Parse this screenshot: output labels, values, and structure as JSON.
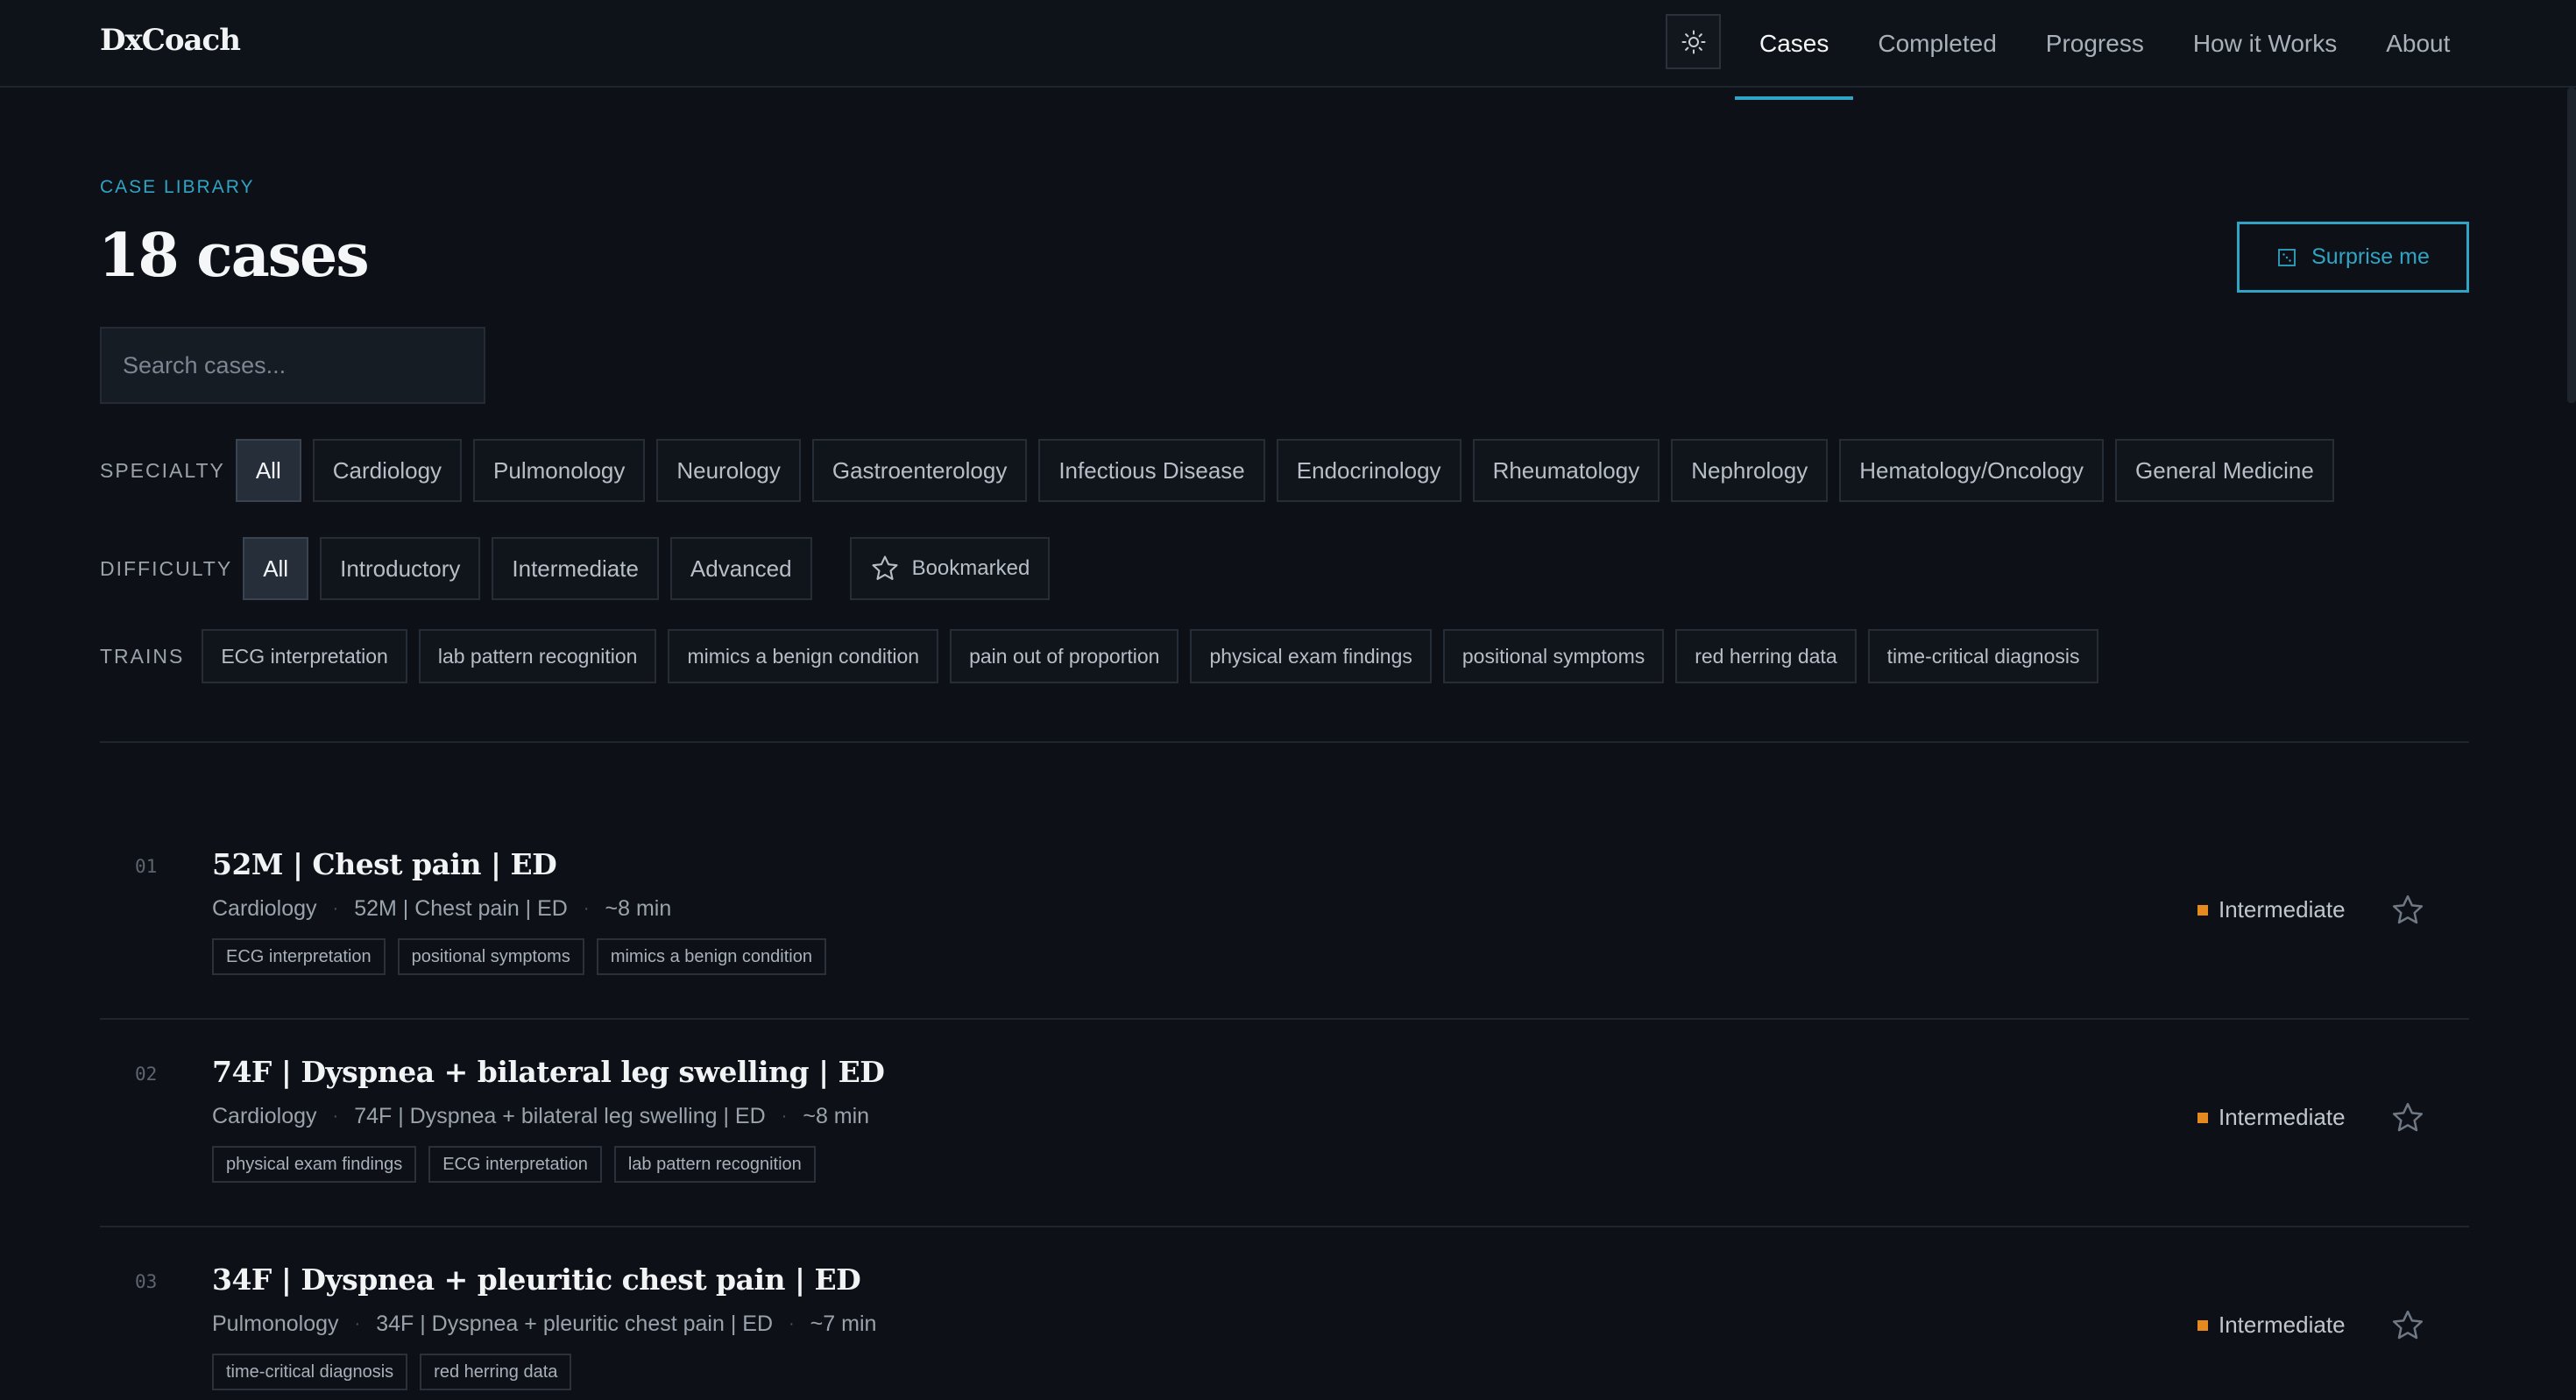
{
  "header": {
    "brand": "DxCoach",
    "theme_icon": "sun-icon",
    "nav": [
      {
        "label": "Cases",
        "active": true
      },
      {
        "label": "Completed",
        "active": false
      },
      {
        "label": "Progress",
        "active": false
      },
      {
        "label": "How it Works",
        "active": false
      },
      {
        "label": "About",
        "active": false
      }
    ]
  },
  "library": {
    "eyebrow": "CASE LIBRARY",
    "title": "18 cases",
    "surprise_label": "Surprise me",
    "surprise_icon": "dice-icon",
    "search_placeholder": "Search cases..."
  },
  "filters": {
    "specialty": {
      "label": "SPECIALTY",
      "options": [
        "All",
        "Cardiology",
        "Pulmonology",
        "Neurology",
        "Gastroenterology",
        "Infectious Disease",
        "Endocrinology",
        "Rheumatology",
        "Nephrology",
        "Hematology/Oncology",
        "General Medicine"
      ],
      "selected": "All"
    },
    "difficulty": {
      "label": "DIFFICULTY",
      "options": [
        "All",
        "Introductory",
        "Intermediate",
        "Advanced"
      ],
      "selected": "All",
      "bookmarked_label": "Bookmarked"
    },
    "trains": {
      "label": "TRAINS",
      "options": [
        "ECG interpretation",
        "lab pattern recognition",
        "mimics a benign condition",
        "pain out of proportion",
        "physical exam findings",
        "positional symptoms",
        "red herring data",
        "time-critical diagnosis"
      ]
    }
  },
  "cases": [
    {
      "num": "01",
      "title": "52M | Chest pain | ED",
      "specialty": "Cardiology",
      "summary": "52M | Chest pain | ED",
      "duration": "~8 min",
      "tags": [
        "ECG interpretation",
        "positional symptoms",
        "mimics a benign condition"
      ],
      "difficulty": "Intermediate"
    },
    {
      "num": "02",
      "title": "74F | Dyspnea + bilateral leg swelling | ED",
      "specialty": "Cardiology",
      "summary": "74F | Dyspnea + bilateral leg swelling | ED",
      "duration": "~8 min",
      "tags": [
        "physical exam findings",
        "ECG interpretation",
        "lab pattern recognition"
      ],
      "difficulty": "Intermediate"
    },
    {
      "num": "03",
      "title": "34F | Dyspnea + pleuritic chest pain | ED",
      "specialty": "Pulmonology",
      "summary": "34F | Dyspnea + pleuritic chest pain | ED",
      "duration": "~7 min",
      "tags": [
        "time-critical diagnosis",
        "red herring data"
      ],
      "difficulty": "Intermediate"
    }
  ],
  "colors": {
    "accent": "#2fa4c4",
    "intermediate": "#e58a1f",
    "background": "#0d1117"
  }
}
